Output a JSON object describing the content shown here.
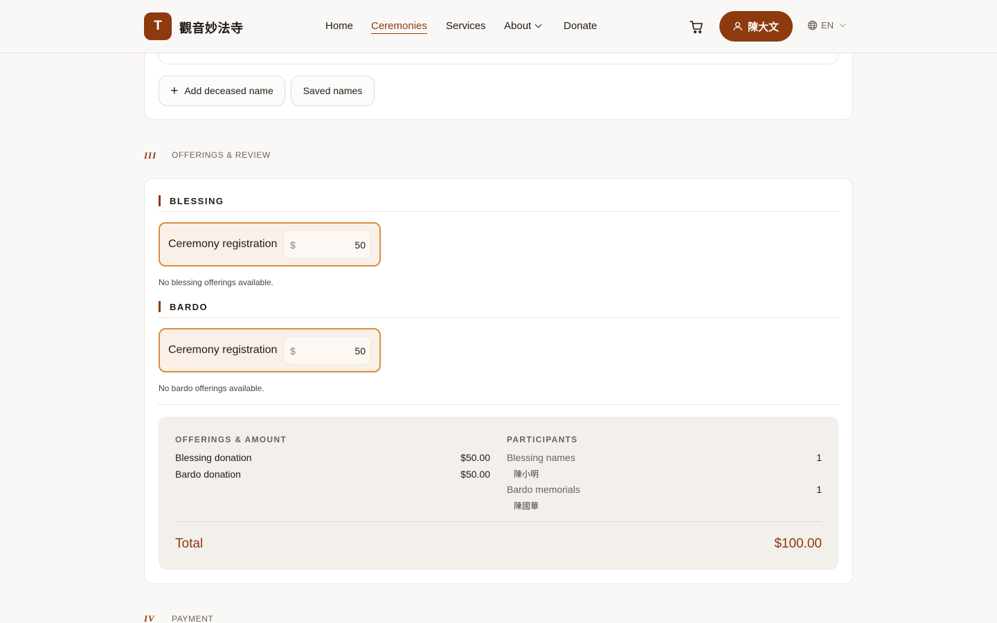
{
  "header": {
    "logo_letter": "T",
    "site_name": "觀音妙法寺",
    "nav": [
      {
        "label": "Home"
      },
      {
        "label": "Ceremonies"
      },
      {
        "label": "Services"
      },
      {
        "label": "About"
      },
      {
        "label": "Donate"
      }
    ],
    "active_nav": "Ceremonies",
    "user_name": "陳大文",
    "language": "EN"
  },
  "names_section": {
    "add_button_label": "Add deceased name",
    "saved_button_label": "Saved names"
  },
  "offerings_section": {
    "number": "III",
    "label": "OFFERINGS & REVIEW",
    "groups": [
      {
        "title": "BLESSING",
        "offering_name": "Ceremony registration",
        "currency": "$",
        "amount": "50",
        "empty_note": "No blessing offerings available."
      },
      {
        "title": "BARDO",
        "offering_name": "Ceremony registration",
        "currency": "$",
        "amount": "50",
        "empty_note": "No bardo offerings available."
      }
    ],
    "summary": {
      "offerings_heading": "OFFERINGS & AMOUNT",
      "offerings": [
        {
          "label": "Blessing donation",
          "amount": "$50.00"
        },
        {
          "label": "Bardo donation",
          "amount": "$50.00"
        }
      ],
      "participants_heading": "PARTICIPANTS",
      "participants": [
        {
          "label": "Blessing names",
          "count": "1",
          "names": [
            "陳小明"
          ]
        },
        {
          "label": "Bardo memorials",
          "count": "1",
          "names": [
            "陳國華"
          ]
        }
      ],
      "total_label": "Total",
      "total_value": "$100.00"
    }
  },
  "payment_section": {
    "number": "IV",
    "label": "PAYMENT"
  },
  "colors": {
    "accent": "#8c3a0e",
    "highlight_border": "#d98c3d",
    "highlight_fill": "#fbf0e8",
    "background": "#faf8f6"
  }
}
